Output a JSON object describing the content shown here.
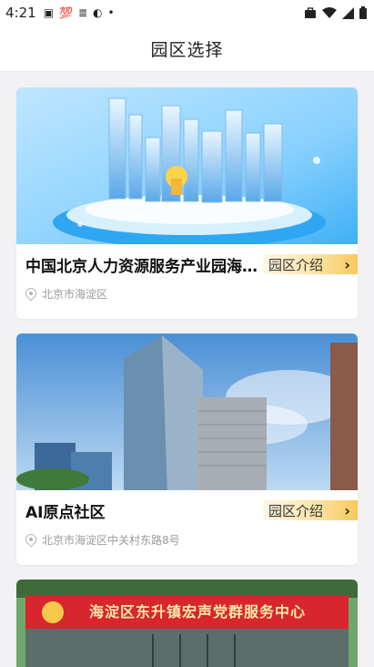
{
  "status_bar": {
    "time": "4:21",
    "icons": [
      "notification-a-icon",
      "notification-100-icon",
      "notification-stack-icon",
      "notification-alert-icon",
      "dot-icon"
    ],
    "right_icons": [
      "briefcase-icon",
      "wifi-icon",
      "signal-icon",
      "battery-icon"
    ]
  },
  "header": {
    "title": "园区选择"
  },
  "parks": [
    {
      "name": "中国北京人力资源服务产业园海...",
      "intro_label": "园区介绍",
      "address": "北京市海淀区"
    },
    {
      "name": "AI原点社区",
      "intro_label": "园区介绍",
      "address": "北京市海淀区中关村东路8号"
    },
    {
      "banner_text": "海淀区东升镇宏声党群服务中心"
    }
  ],
  "colors": {
    "accent_gold": "#f8c95a",
    "banner_red": "#d7262e"
  }
}
